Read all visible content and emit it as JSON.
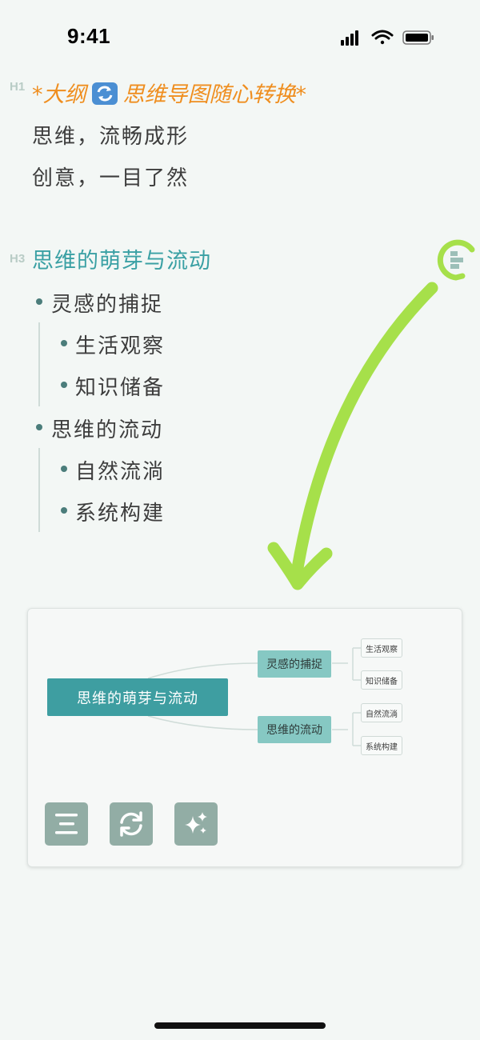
{
  "status_bar": {
    "time": "9:41"
  },
  "outline": {
    "h1_tag": "H1",
    "h1_prefix": "*大纲",
    "h1_suffix": "思维导图随心转换*",
    "paragraphs": [
      "思维，流畅成形",
      "创意，一目了然"
    ],
    "h3_tag": "H3",
    "h3_title": "思维的萌芽与流动",
    "items": [
      {
        "label": "灵感的捕捉",
        "children": [
          "生活观察",
          "知识储备"
        ]
      },
      {
        "label": "思维的流动",
        "children": [
          "自然流淌",
          "系统构建"
        ]
      }
    ]
  },
  "mindmap": {
    "root": "思维的萌芽与流动",
    "branches": [
      {
        "label": "灵感的捕捉",
        "leaves": [
          "生活观察",
          "知识储备"
        ]
      },
      {
        "label": "思维的流动",
        "leaves": [
          "自然流淌",
          "系统构建"
        ]
      }
    ]
  },
  "toolbar": {
    "buttons": [
      "outline-icon",
      "sync-icon",
      "ai-sparkle-icon"
    ]
  },
  "colors": {
    "accent": "#3aa0a4",
    "h1": "#ef8e1f",
    "arrow": "#a6e04a",
    "background": "#f3f7f5"
  }
}
